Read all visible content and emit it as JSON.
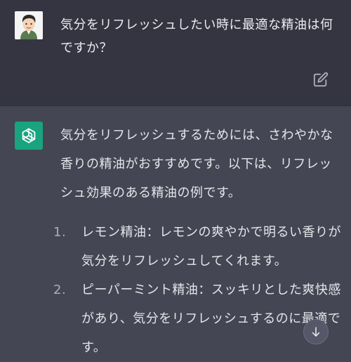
{
  "user_message": {
    "text": "気分をリフレッシュしたい時に最適な精油は何ですか？"
  },
  "assistant_message": {
    "intro": "気分をリフレッシュするためには、さわやかな香りの精油がおすすめです。以下は、リフレッシュ効果のある精油の例です。",
    "items": [
      {
        "number": "1.",
        "text": "レモン精油：レモンの爽やかで明るい香りが気分をリフレッシュしてくれます。"
      },
      {
        "number": "2.",
        "text": "ピーパーミント精油：スッキリとした爽快感があり、気分をリフレッシュするのに最適です。"
      }
    ]
  },
  "icons": {
    "user_avatar": "user-avatar-illustration",
    "bot_avatar": "openai-logo-icon",
    "edit": "edit-icon",
    "scroll_down": "arrow-down-icon"
  },
  "colors": {
    "user_bg": "#343541",
    "assistant_bg": "#444654",
    "bot_avatar_bg": "#19a37f",
    "text": "#ececf1"
  }
}
